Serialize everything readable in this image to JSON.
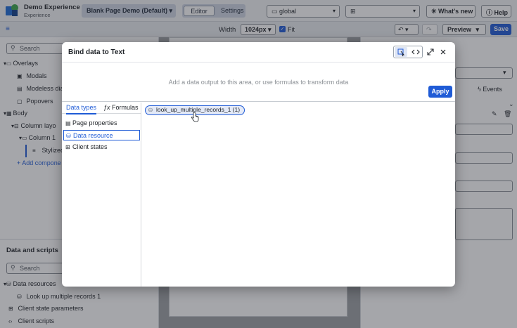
{
  "header": {
    "app_title": "Demo Experience",
    "app_subtitle": "Experience",
    "page_selector": "Blank Page Demo (Default)",
    "mode_tabs": [
      "Editor",
      "Settings"
    ],
    "scope_dropdown": "global",
    "whats_new": "What's new",
    "help": "Help"
  },
  "toolbar": {
    "width_label": "Width",
    "width_value": "1024px",
    "fit_label": "Fit",
    "preview": "Preview",
    "save": "Save"
  },
  "left_panel": {
    "search_placeholder": "Search",
    "tree": [
      "Overlays",
      "Modals",
      "Modeless dia",
      "Popovers",
      "Body",
      "Column layo",
      "Column 1",
      "Stylized",
      "+ Add compone"
    ],
    "data_scripts_title": "Data and scripts",
    "search2_placeholder": "Search",
    "data_tree": [
      "Data resources",
      "Look up multiple records 1",
      "Client state parameters",
      "Client scripts"
    ]
  },
  "right_panel": {
    "events_tab": "Events"
  },
  "modal": {
    "title": "Bind data to Text",
    "drop_hint": "Add a data output to this area, or use formulas to transform data",
    "apply": "Apply",
    "tabs": [
      "Data types",
      "Formulas"
    ],
    "items": [
      "Page properties",
      "Data resource",
      "Client states"
    ],
    "selected_item": 1,
    "chip_label": "look_up_multiple_records_1 (1)"
  },
  "colors": {
    "accent": "#1f5bd6",
    "chip_bg": "#e3e9f7"
  },
  "icons": [
    "list-icon",
    "database-icon",
    "state-icon",
    "pick-icon",
    "code-icon",
    "expand-icon",
    "close-icon",
    "hand-cursor-icon"
  ]
}
